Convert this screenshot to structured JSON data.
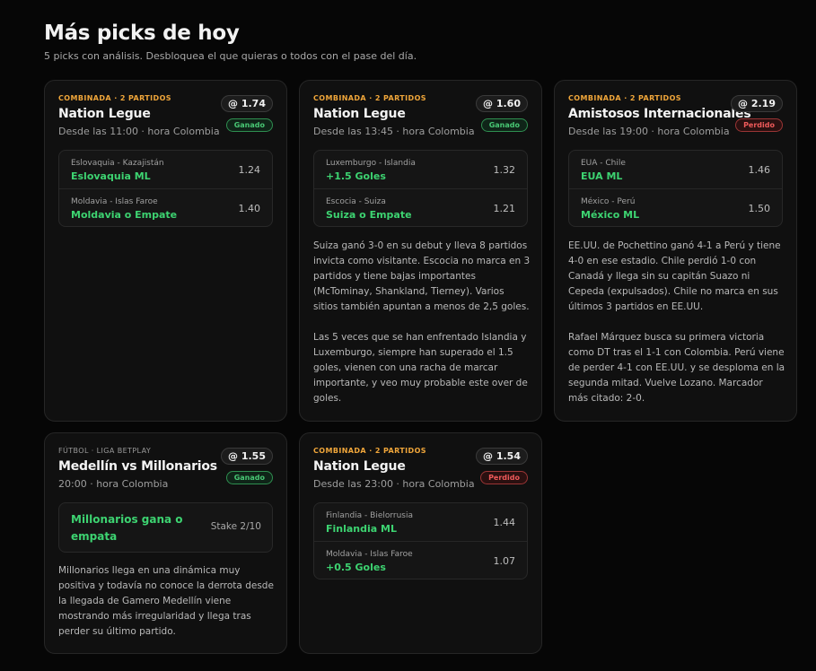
{
  "header": {
    "title": "Más picks de hoy",
    "subtitle": "5 picks con análisis. Desbloquea el que quieras o todos con el pase del día."
  },
  "colors": {
    "accent": "#f0a63a",
    "won": "#48c774",
    "lost": "#ef5a5a",
    "pick": "#3dd371"
  },
  "cards": [
    {
      "kicker": "COMBINADA · 2 PARTIDOS",
      "title": "Nation Legue",
      "time": "Desde las 11:00 · hora Colombia",
      "odds": "@ 1.74",
      "status": "Ganado",
      "legs": [
        {
          "match": "Eslovaquia - Kazajistán",
          "pick": "Eslovaquia ML",
          "odds": "1.24"
        },
        {
          "match": "Moldavia - Islas Faroe",
          "pick": "Moldavia o Empate",
          "odds": "1.40"
        }
      ]
    },
    {
      "kicker": "COMBINADA · 2 PARTIDOS",
      "title": "Nation Legue",
      "time": "Desde las 13:45 · hora Colombia",
      "odds": "@ 1.60",
      "status": "Ganado",
      "legs": [
        {
          "match": "Luxemburgo - Islandia",
          "pick": "+1.5 Goles",
          "odds": "1.32"
        },
        {
          "match": "Escocia - Suiza",
          "pick": "Suiza o Empate",
          "odds": "1.21"
        }
      ],
      "analysis": [
        "Suiza ganó 3-0 en su debut y lleva 8 partidos invicta como visitante. Escocia no marca en 3 partidos y tiene bajas importantes (McTominay, Shankland, Tierney). Varios sitios también apuntan a menos de 2,5 goles.",
        "Las 5 veces que se han enfrentado Islandia y Luxemburgo, siempre han superado el 1.5 goles, vienen con una racha de marcar importante, y veo muy probable este over de goles."
      ]
    },
    {
      "kicker": "COMBINADA · 2 PARTIDOS",
      "title": "Amistosos Internacionales",
      "time": "Desde las 19:00 · hora Colombia",
      "odds": "@ 2.19",
      "status": "Perdido",
      "legs": [
        {
          "match": "EUA - Chile",
          "pick": "EUA ML",
          "odds": "1.46"
        },
        {
          "match": "México - Perú",
          "pick": "México ML",
          "odds": "1.50"
        }
      ],
      "analysis": [
        "EE.UU. de Pochettino ganó 4-1 a Perú y tiene 4-0 en ese estadio. Chile perdió 1-0 con Canadá y llega sin su capitán Suazo ni Cepeda (expulsados). Chile no marca en sus últimos 3 partidos en EE.UU.",
        "Rafael Márquez busca su primera victoria como DT tras el 1-1 con Colombia. Perú viene de perder 4-1 con EE.UU. y se desploma en la segunda mitad. Vuelve Lozano. Marcador más citado: 2-0."
      ]
    },
    {
      "kicker": "FÚTBOL · LIGA BETPLAY",
      "title": "Medellín vs Millonarios",
      "time": "20:00 · hora Colombia",
      "odds": "@ 1.55",
      "status": "Ganado",
      "pick": "Millonarios gana o empata",
      "stake": "Stake 2/10",
      "analysis": [
        "Millonarios llega en una dinámica muy positiva y todavía no conoce la derrota desde la llegada de Gamero Medellín viene mostrando más irregularidad y llega tras perder su último partido."
      ]
    },
    {
      "kicker": "COMBINADA · 2 PARTIDOS",
      "title": "Nation Legue",
      "time": "Desde las 23:00 · hora Colombia",
      "odds": "@ 1.54",
      "status": "Perdido",
      "legs": [
        {
          "match": "Finlandia - Bielorrusia",
          "pick": "Finlandia ML",
          "odds": "1.44"
        },
        {
          "match": "Moldavia - Islas Faroe",
          "pick": "+0.5 Goles",
          "odds": "1.07"
        }
      ]
    }
  ]
}
